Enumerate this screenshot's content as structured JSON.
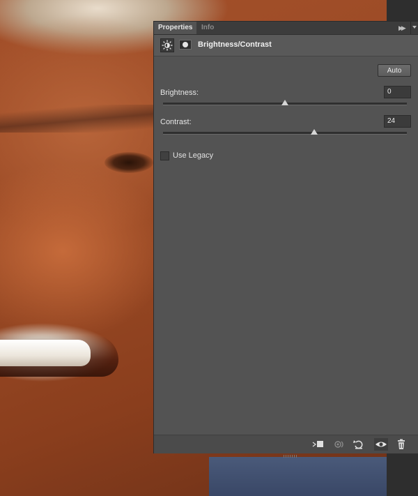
{
  "tabs": [
    {
      "label": "Properties",
      "active": true
    },
    {
      "label": "Info",
      "active": false
    }
  ],
  "panel_menu": {
    "icon": "double-chevron-right-icon"
  },
  "header": {
    "adjustment_icon": "brightness-sun-icon",
    "mask_icon": "layer-mask-icon",
    "title": "Brightness/Contrast"
  },
  "auto_button": {
    "label": "Auto"
  },
  "brightness": {
    "label": "Brightness:",
    "value": "0",
    "slider_fraction": 0.5
  },
  "contrast": {
    "label": "Contrast:",
    "value": "24",
    "slider_fraction": 0.62
  },
  "legacy": {
    "label": "Use Legacy",
    "checked": false
  },
  "footer_buttons": [
    {
      "name": "clip-to-layer-icon"
    },
    {
      "name": "view-previous-state-icon"
    },
    {
      "name": "reset-adjustment-icon"
    },
    {
      "name": "visibility-eye-icon"
    },
    {
      "name": "trash-icon"
    }
  ],
  "colors": {
    "panel_bg": "#535353",
    "tabbar_bg": "#3c3c3c",
    "field_bg": "#3b3b3b"
  }
}
